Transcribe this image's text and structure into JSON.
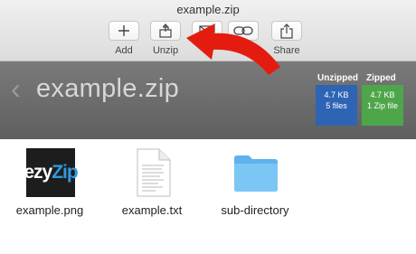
{
  "window": {
    "title": "example.zip"
  },
  "toolbar": {
    "buttons": [
      {
        "icon": "plus-icon",
        "label": "Add"
      },
      {
        "icon": "unzip-icon",
        "label": "Unzip"
      },
      {
        "icon": "mail-icon",
        "label": ""
      },
      {
        "icon": "link-icon",
        "label": ""
      },
      {
        "icon": "share-icon",
        "label": "Share"
      }
    ]
  },
  "banner": {
    "archive_name": "example.zip",
    "unzipped": {
      "header": "Unzipped",
      "size": "4.7 KB",
      "detail": "5 files",
      "color": "#2e64b4"
    },
    "zipped": {
      "header": "Zipped",
      "size": "4.7 KB",
      "detail": "1 Zip file",
      "color": "#4ea64a"
    }
  },
  "files": [
    {
      "name": "example.png",
      "icon": "png-thumbnail",
      "logo_text_a": "ezy",
      "logo_text_b": "Zip"
    },
    {
      "name": "example.txt",
      "icon": "text-document-icon"
    },
    {
      "name": "sub-directory",
      "icon": "folder-icon"
    }
  ],
  "accent": {
    "arrow": "#e41c10"
  }
}
